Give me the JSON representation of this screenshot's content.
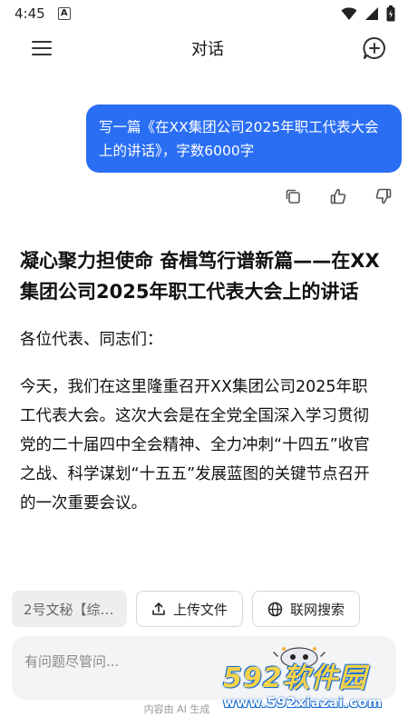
{
  "status": {
    "time": "4:45",
    "notif_letter": "A"
  },
  "appbar": {
    "title": "对话"
  },
  "user_message": {
    "text": "写一篇《在XX集团公司2025年职工代表大会上的讲话》，字数6000字"
  },
  "answer": {
    "title": "凝心聚力担使命 奋楫笃行谱新篇——在XX集团公司2025年职工代表大会上的讲话",
    "greeting": "各位代表、同志们：",
    "paragraph": "今天，我们在这里隆重召开XX集团公司2025年职工代表大会。这次大会是在全党全国深入学习贯彻党的二十届四中全会精神、全力冲刺“十四五”收官之战、科学谋划“十五五”发展蓝图的关键节点召开的一次重要会议。"
  },
  "chips": {
    "writer_select": "2号文秘【综…",
    "upload": "上传文件",
    "web_search": "联网搜索"
  },
  "input": {
    "placeholder": "有问题尽管问..."
  },
  "footer": {
    "text": "内容由 AI 生成"
  },
  "watermark": {
    "logo": "592软件园",
    "url": "www.592xiazai.com"
  },
  "colors": {
    "accent": "#2a6ef4",
    "input_bg": "#f3f4f6"
  }
}
